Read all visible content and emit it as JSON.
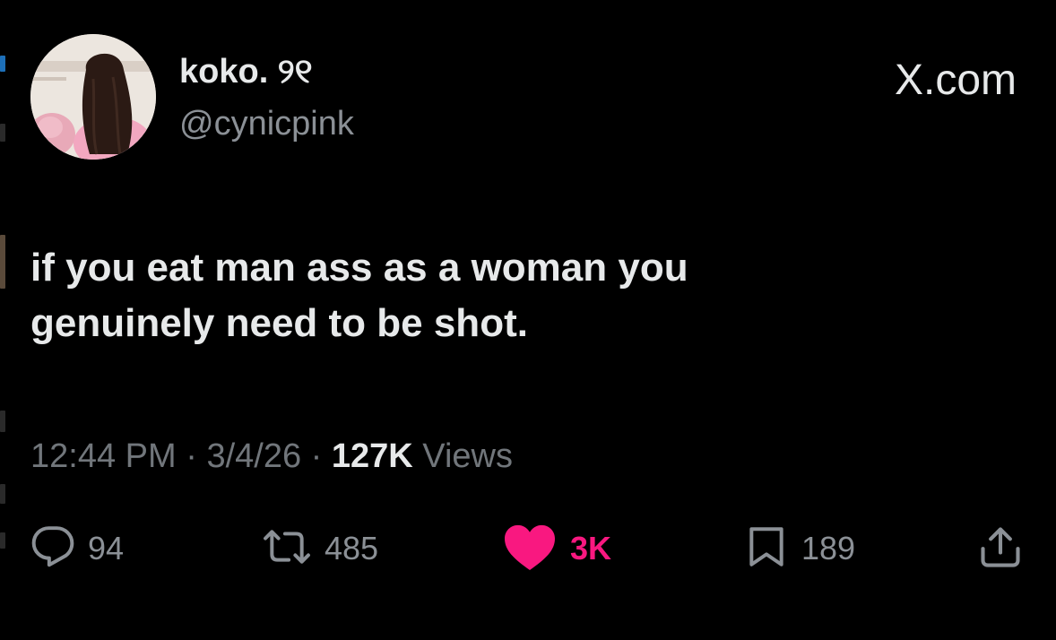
{
  "author": {
    "display_name": "koko. ୨୧",
    "handle": "@cynicpink",
    "avatar_icon": "profile-photo"
  },
  "brand": {
    "label": "X.com"
  },
  "tweet": {
    "lines": [
      "if you eat man ass as a woman you",
      "genuinely need to be shot."
    ]
  },
  "meta": {
    "time": "12:44 PM",
    "separator": "·",
    "date": "3/4/26",
    "views_count": "127K",
    "views_label": "Views"
  },
  "actions": {
    "reply": {
      "icon": "reply-icon",
      "count": "94"
    },
    "repost": {
      "icon": "repost-icon",
      "count": "485"
    },
    "like": {
      "icon": "heart-icon",
      "count": "3K",
      "color": "#f91880"
    },
    "bookmark": {
      "icon": "bookmark-icon",
      "count": "189"
    },
    "share": {
      "icon": "share-icon"
    }
  },
  "colors": {
    "background": "#000000",
    "primary_text": "#e7e9ea",
    "secondary_text": "#71767b",
    "like_accent": "#f91880"
  }
}
